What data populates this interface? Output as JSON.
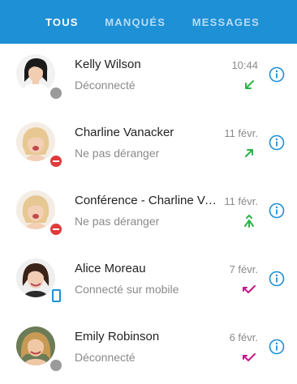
{
  "tabs": [
    {
      "label": "TOUS",
      "active": true
    },
    {
      "label": "MANQUÉS",
      "active": false
    },
    {
      "label": "MESSAGES",
      "active": false
    }
  ],
  "contacts": [
    {
      "name": "Kelly Wilson",
      "status": "Déconnecté",
      "time": "10:44",
      "presence": "offline",
      "call": "incoming-call-icon",
      "call_color": "#2bb34a"
    },
    {
      "name": "Charline Vanacker",
      "status": "Ne pas déranger",
      "time": "11 févr.",
      "presence": "dnd",
      "call": "outgoing-call-icon",
      "call_color": "#2bb34a"
    },
    {
      "name": "Conférence - Charline Vanacker",
      "status": "Ne pas déranger",
      "time": "11 févr.",
      "presence": "dnd",
      "call": "conference-call-icon",
      "call_color": "#2bb34a"
    },
    {
      "name": "Alice Moreau",
      "status": "Connecté sur mobile",
      "time": "7 févr.",
      "presence": "mobile",
      "call": "missed-call-icon",
      "call_color": "#c2188a"
    },
    {
      "name": "Emily Robinson",
      "status": "Déconnecté",
      "time": "6 févr.",
      "presence": "offline",
      "call": "missed-call-icon",
      "call_color": "#c2188a"
    }
  ],
  "colors": {
    "header": "#1e90d6",
    "accent": "#1e90d6"
  }
}
